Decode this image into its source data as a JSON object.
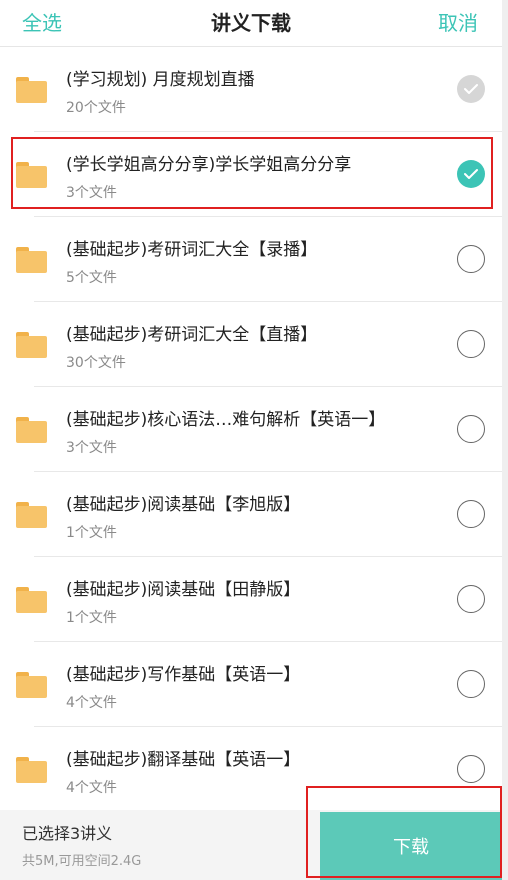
{
  "header": {
    "select_all": "全选",
    "title": "讲义下载",
    "cancel": "取消"
  },
  "items": [
    {
      "name": "(学习规划) 月度规划直播",
      "count": "20个文件",
      "state": "disabled"
    },
    {
      "name": "(学长学姐高分分享)学长学姐高分分享",
      "count": "3个文件",
      "state": "selected"
    },
    {
      "name": "(基础起步)考研词汇大全【录播】",
      "count": "5个文件",
      "state": "empty"
    },
    {
      "name": "(基础起步)考研词汇大全【直播】",
      "count": "30个文件",
      "state": "empty"
    },
    {
      "name": "(基础起步)核心语法…难句解析【英语一】",
      "count": "3个文件",
      "state": "empty"
    },
    {
      "name": "(基础起步)阅读基础【李旭版】",
      "count": "1个文件",
      "state": "empty"
    },
    {
      "name": "(基础起步)阅读基础【田静版】",
      "count": "1个文件",
      "state": "empty"
    },
    {
      "name": "(基础起步)写作基础【英语一】",
      "count": "4个文件",
      "state": "empty"
    },
    {
      "name": "(基础起步)翻译基础【英语一】",
      "count": "4个文件",
      "state": "empty"
    }
  ],
  "footer": {
    "selected_text": "已选择3讲义",
    "space_text": "共5M,可用空间2.4G",
    "download_label": "下载"
  },
  "colors": {
    "accent": "#3cc4b6",
    "folder": "#f7c46a",
    "highlight": "#e02020"
  },
  "icons": {
    "folder": "folder-icon",
    "check": "checkmark-icon"
  }
}
